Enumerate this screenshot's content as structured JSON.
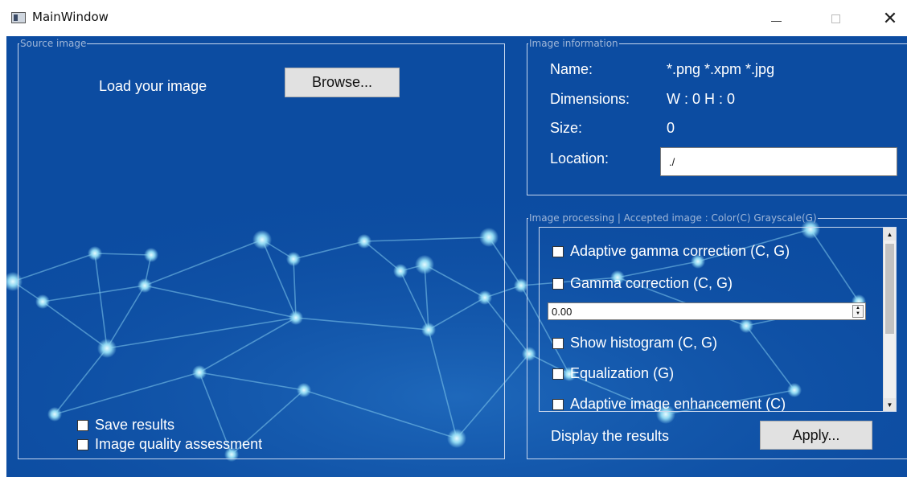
{
  "window": {
    "title": "MainWindow",
    "minimize_symbol": "—",
    "close_symbol": "✕"
  },
  "source": {
    "legend": "Source image",
    "load_label": "Load your image",
    "browse_label": "Browse...",
    "save_results_label": "Save results",
    "save_results_checked": false,
    "quality_label": "Image quality assessment",
    "quality_checked": false
  },
  "info": {
    "legend": "Image information",
    "name_label": "Name:",
    "name_value": "*.png *.xpm *.jpg",
    "dimensions_label": "Dimensions:",
    "dimensions_value": "W : 0  H : 0",
    "size_label": "Size:",
    "size_value": "0",
    "location_label": "Location:",
    "location_value": "./"
  },
  "processing": {
    "legend": "Image processing | Accepted image : Color(C) Grayscale(G)",
    "options": [
      {
        "label": "Adaptive gamma correction (C, G)",
        "checked": false
      },
      {
        "label": "Gamma correction (C, G)",
        "checked": false
      },
      {
        "label": "Show histogram (C, G)",
        "checked": false
      },
      {
        "label": "Equalization (G)",
        "checked": false
      },
      {
        "label": "Adaptive image enhancement (C)",
        "checked": false
      }
    ],
    "gamma_value": "0.00",
    "display_label": "Display the results",
    "apply_label": "Apply..."
  },
  "icons": {
    "app": "window-app-icon",
    "scroll_up": "scroll-up-arrow-icon",
    "scroll_down": "scroll-down-arrow-icon",
    "spin": "spin-up-down-icon"
  },
  "colors": {
    "background": "#0c4ca1",
    "node": "#8fd3ef",
    "button": "#e1e1e1"
  }
}
